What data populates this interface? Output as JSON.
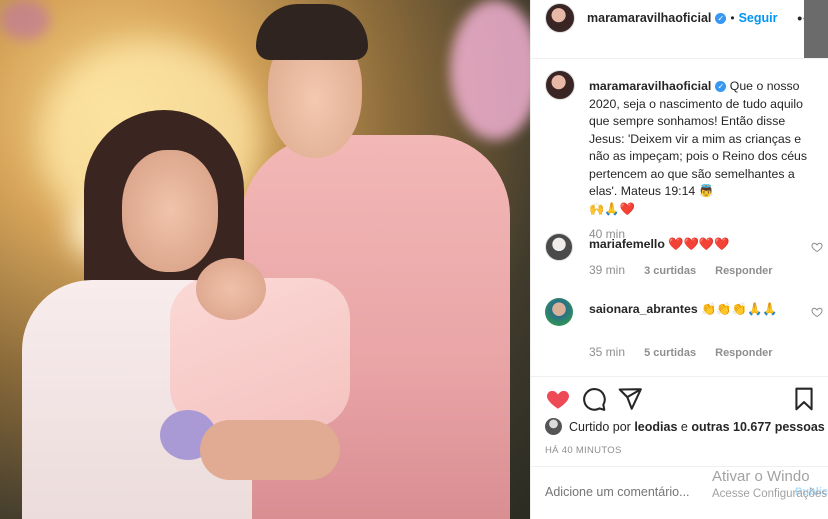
{
  "post": {
    "username": "maramaravilhaoficial",
    "follow_label": "Seguir",
    "more_label": "•••"
  },
  "caption": {
    "username": "maramaravilhaoficial",
    "text": "Que o nosso 2020, seja o nascimento de tudo aquilo que sempre sonhamos! Então disse Jesus: 'Deixem vir a mim as crianças e não as impeçam; pois o Reino dos céus pertencem ao que são semelhantes a elas'. Mateus 19:14 👼",
    "emojis": "🙌🙏❤️",
    "time": "40 min"
  },
  "comments": [
    {
      "username": "mariafemello",
      "text": "❤️❤️❤️❤️",
      "time": "39 min",
      "likes": "3 curtidas",
      "reply_label": "Responder"
    },
    {
      "username": "saionara_abrantes",
      "text": "👏👏👏🙏🙏",
      "time": "35 min",
      "likes": "5 curtidas",
      "reply_label": "Responder"
    }
  ],
  "likes": {
    "prefix": "Curtido por",
    "user": "leodias",
    "middle": "e",
    "others": "outras 10.677 pessoas"
  },
  "posted_ago": "HÁ 40 MINUTOS",
  "comment_input": {
    "placeholder": "Adicione um comentário...",
    "publish_label": "Publicar"
  },
  "watermark": {
    "line1": "Ativar o Windo",
    "line2": "Acesse Configurações"
  },
  "colors": {
    "link_blue": "#0095f6",
    "like_red": "#ed4956",
    "muted": "#8e8e8e"
  }
}
